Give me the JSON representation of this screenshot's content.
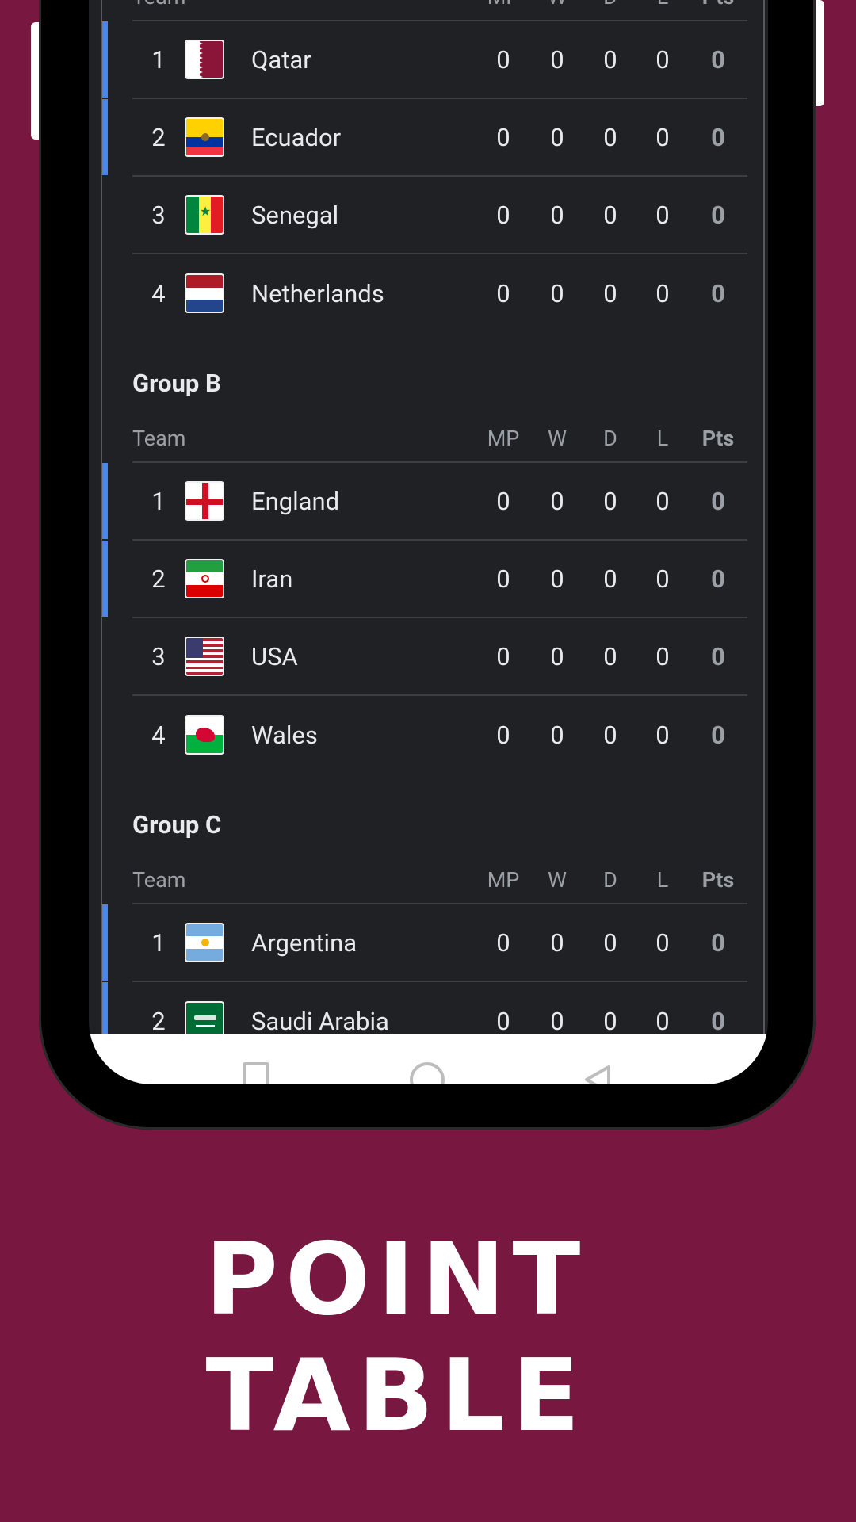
{
  "headers": {
    "team": "Team",
    "mp": "MP",
    "w": "W",
    "d": "D",
    "l": "L",
    "pts": "Pts"
  },
  "groups": [
    {
      "title": "",
      "rows": [
        {
          "rank": "1",
          "team": "Qatar",
          "flag": "qatar-flag",
          "mp": "0",
          "w": "0",
          "d": "0",
          "l": "0",
          "pts": "0",
          "qualifying": true
        },
        {
          "rank": "2",
          "team": "Ecuador",
          "flag": "ecuador-flag",
          "mp": "0",
          "w": "0",
          "d": "0",
          "l": "0",
          "pts": "0",
          "qualifying": true
        },
        {
          "rank": "3",
          "team": "Senegal",
          "flag": "senegal-flag",
          "mp": "0",
          "w": "0",
          "d": "0",
          "l": "0",
          "pts": "0",
          "qualifying": false
        },
        {
          "rank": "4",
          "team": "Netherlands",
          "flag": "netherlands-flag",
          "mp": "0",
          "w": "0",
          "d": "0",
          "l": "0",
          "pts": "0",
          "qualifying": false
        }
      ]
    },
    {
      "title": "Group B",
      "rows": [
        {
          "rank": "1",
          "team": "England",
          "flag": "england-flag",
          "mp": "0",
          "w": "0",
          "d": "0",
          "l": "0",
          "pts": "0",
          "qualifying": true
        },
        {
          "rank": "2",
          "team": "Iran",
          "flag": "iran-flag",
          "mp": "0",
          "w": "0",
          "d": "0",
          "l": "0",
          "pts": "0",
          "qualifying": true
        },
        {
          "rank": "3",
          "team": "USA",
          "flag": "usa-flag",
          "mp": "0",
          "w": "0",
          "d": "0",
          "l": "0",
          "pts": "0",
          "qualifying": false
        },
        {
          "rank": "4",
          "team": "Wales",
          "flag": "wales-flag",
          "mp": "0",
          "w": "0",
          "d": "0",
          "l": "0",
          "pts": "0",
          "qualifying": false
        }
      ]
    },
    {
      "title": "Group C",
      "rows": [
        {
          "rank": "1",
          "team": "Argentina",
          "flag": "argentina-flag",
          "mp": "0",
          "w": "0",
          "d": "0",
          "l": "0",
          "pts": "0",
          "qualifying": true
        },
        {
          "rank": "2",
          "team": "Saudi Arabia",
          "flag": "saudi-arabia-flag",
          "mp": "0",
          "w": "0",
          "d": "0",
          "l": "0",
          "pts": "0",
          "qualifying": true
        }
      ]
    }
  ],
  "caption": "POINT TABLE",
  "colors": {
    "background": "#781840",
    "screen": "#202124",
    "qualify_bar": "#4a86e8",
    "text": "#e8eaed",
    "muted": "#9aa0a6"
  },
  "nav_icons": [
    "recent-apps-icon",
    "home-icon",
    "back-icon"
  ]
}
